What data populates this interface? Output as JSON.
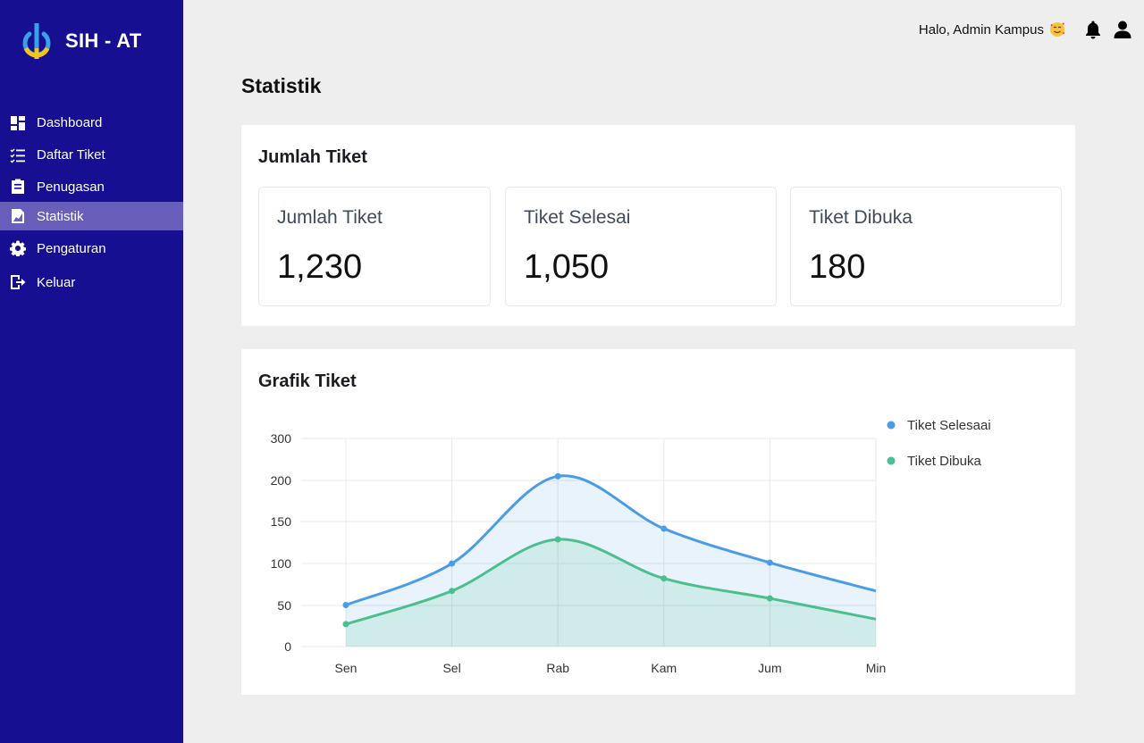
{
  "sidebar": {
    "brand": "SIH - AT",
    "items": [
      {
        "label": "Dashboard",
        "icon": "dashboard-icon"
      },
      {
        "label": "Daftar Tiket",
        "icon": "checklist-icon"
      },
      {
        "label": "Penugasan",
        "icon": "assignment-icon"
      },
      {
        "label": "Statistik",
        "icon": "chart-icon",
        "active": true
      },
      {
        "label": "Pengaturan",
        "icon": "gear-icon"
      },
      {
        "label": "Keluar",
        "icon": "logout-icon"
      }
    ]
  },
  "header": {
    "greeting": "Halo, Admin Kampus",
    "emoji": "smiling-face-with-hearts",
    "icons": [
      "bell-icon",
      "user-icon"
    ]
  },
  "page_title": "Statistik",
  "summary": {
    "title": "Jumlah Tiket",
    "stats": [
      {
        "label": "Jumlah Tiket",
        "value": "1,230"
      },
      {
        "label": "Tiket Selesai",
        "value": "1,050"
      },
      {
        "label": "Tiket Dibuka",
        "value": "180"
      }
    ]
  },
  "chart_section": {
    "title": "Grafik Tiket"
  },
  "colors": {
    "sidebar_bg": "#160f92",
    "sidebar_active": "#675fb9",
    "series_selesai": "#4a9be8",
    "series_dibuka": "#4cbf8f",
    "logo_blue": "#3aa1e8",
    "logo_yellow": "#f4c51a"
  },
  "chart_data": {
    "type": "area",
    "categories": [
      "Sen",
      "Sel",
      "Rab",
      "Kam",
      "Jum",
      "Min"
    ],
    "ylim": [
      0,
      300
    ],
    "yticks": [
      0,
      50,
      100,
      150,
      200,
      300
    ],
    "grid": true,
    "legend_position": "top-right",
    "series": [
      {
        "name": "Tiket Selesaai",
        "values": [
          50,
          100,
          210,
          142,
          101,
          67
        ],
        "color": "#4a9be8"
      },
      {
        "name": "Tiket Dibuka",
        "values": [
          27,
          67,
          129,
          82,
          58,
          33
        ],
        "color": "#4cbf8f"
      }
    ]
  }
}
